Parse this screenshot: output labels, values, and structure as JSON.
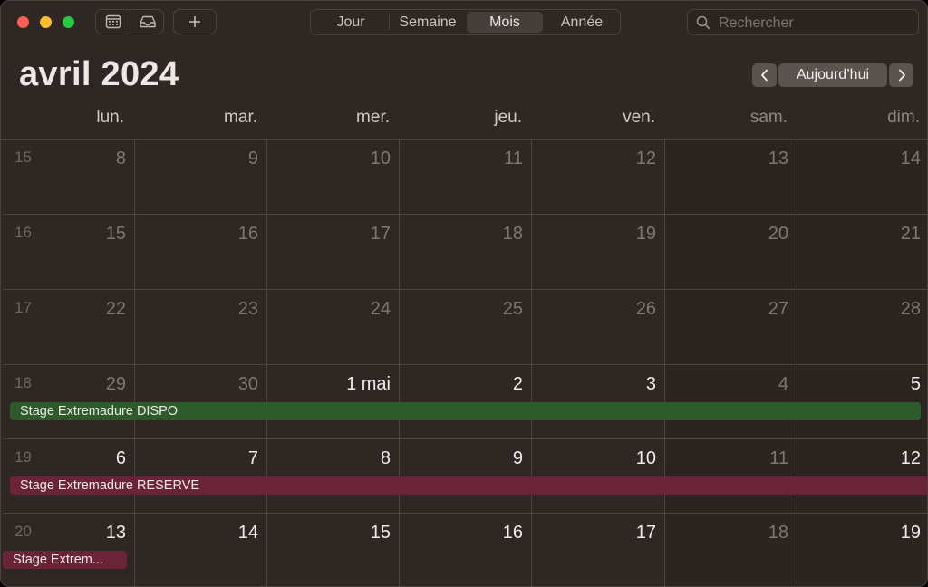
{
  "toolbar": {
    "add_label": "+",
    "view_tabs": [
      "Jour",
      "Semaine",
      "Mois",
      "Année"
    ],
    "active_view": "Mois",
    "search_placeholder": "Rechercher",
    "icons": [
      "calendar-list-icon",
      "inbox-icon",
      "search-icon"
    ]
  },
  "header": {
    "month_title": "avril 2024",
    "prev_label": "‹",
    "today_label": "Aujourd’hui",
    "next_label": "›"
  },
  "weekdays": [
    "lun.",
    "mar.",
    "mer.",
    "jeu.",
    "ven.",
    "sam.",
    "dim."
  ],
  "weeks": [
    {
      "number": "15",
      "days": [
        "8",
        "9",
        "10",
        "11",
        "12",
        "13",
        "14"
      ],
      "current": [
        false,
        false,
        false,
        false,
        false,
        false,
        false
      ]
    },
    {
      "number": "16",
      "days": [
        "15",
        "16",
        "17",
        "18",
        "19",
        "20",
        "21"
      ],
      "current": [
        false,
        false,
        false,
        false,
        false,
        false,
        false
      ]
    },
    {
      "number": "17",
      "days": [
        "22",
        "23",
        "24",
        "25",
        "26",
        "27",
        "28"
      ],
      "current": [
        false,
        false,
        false,
        false,
        false,
        false,
        false
      ]
    },
    {
      "number": "18",
      "days": [
        "29",
        "30",
        "1 mai",
        "2",
        "3",
        "4",
        "5"
      ],
      "current": [
        false,
        false,
        true,
        true,
        true,
        false,
        true
      ]
    },
    {
      "number": "19",
      "days": [
        "6",
        "7",
        "8",
        "9",
        "10",
        "11",
        "12"
      ],
      "current": [
        true,
        true,
        true,
        true,
        true,
        false,
        true
      ]
    },
    {
      "number": "20",
      "days": [
        "13",
        "14",
        "15",
        "16",
        "17",
        "18",
        "19"
      ],
      "current": [
        true,
        true,
        true,
        true,
        true,
        false,
        true
      ]
    }
  ],
  "events": [
    {
      "title": "Stage Extremadure DISPO",
      "week": 3,
      "color": "#2f5b2c"
    },
    {
      "title": "Stage Extremadure RESERVE",
      "week": 4,
      "color": "#6a2339"
    },
    {
      "title": "Stage Extrem...",
      "week": 5,
      "color": "#6a2339"
    }
  ],
  "colors": {
    "window_bg": "#2e2724",
    "grid_line": "#4d4541",
    "event_green": "#2f5b2c",
    "event_maroon": "#6a2339"
  }
}
